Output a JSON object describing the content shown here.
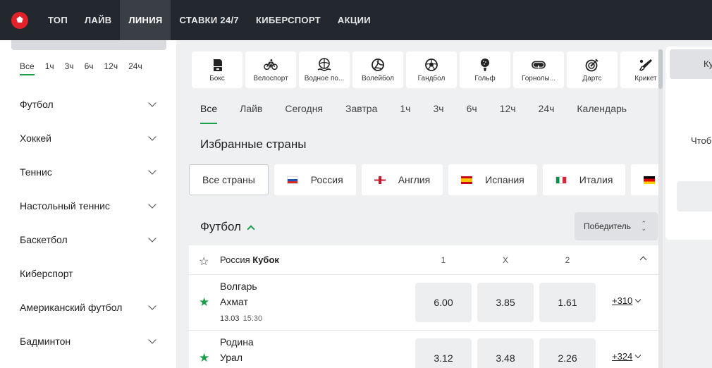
{
  "nav": {
    "items": [
      {
        "label": "ТОП"
      },
      {
        "label": "ЛАЙВ"
      },
      {
        "label": "ЛИНИЯ",
        "active": true
      },
      {
        "label": "СТАВКИ 24/7"
      },
      {
        "label": "КИБЕРСПОРТ"
      },
      {
        "label": "АКЦИИ"
      }
    ]
  },
  "sidebar": {
    "time_filters": [
      "Все",
      "1ч",
      "3ч",
      "6ч",
      "12ч",
      "24ч"
    ],
    "sports": [
      {
        "label": "Футбол",
        "expandable": true
      },
      {
        "label": "Хоккей",
        "expandable": true
      },
      {
        "label": "Теннис",
        "expandable": true
      },
      {
        "label": "Настольный теннис",
        "expandable": true
      },
      {
        "label": "Баскетбол",
        "expandable": true
      },
      {
        "label": "Киберспорт",
        "expandable": false
      },
      {
        "label": "Американский футбол",
        "expandable": true
      },
      {
        "label": "Бадминтон",
        "expandable": true
      }
    ]
  },
  "sport_tiles": [
    {
      "label": "Бокс",
      "icon": "boxing-glove-icon"
    },
    {
      "label": "Велоспорт",
      "icon": "bicycle-icon"
    },
    {
      "label": "Водное по...",
      "icon": "water-polo-icon"
    },
    {
      "label": "Волейбол",
      "icon": "volleyball-icon"
    },
    {
      "label": "Гандбол",
      "icon": "handball-icon"
    },
    {
      "label": "Гольф",
      "icon": "golf-icon"
    },
    {
      "label": "Горнолы...",
      "icon": "ski-goggles-icon"
    },
    {
      "label": "Дартс",
      "icon": "darts-icon"
    },
    {
      "label": "Крикет",
      "icon": "cricket-icon"
    }
  ],
  "tabs": [
    "Все",
    "Лайв",
    "Сегодня",
    "Завтра",
    "1ч",
    "3ч",
    "6ч",
    "12ч",
    "24ч",
    "Календарь"
  ],
  "favorites_title": "Избранные страны",
  "countries": [
    {
      "label": "Все страны",
      "flag": ""
    },
    {
      "label": "Россия",
      "flag": "russia"
    },
    {
      "label": "Англия",
      "flag": "england"
    },
    {
      "label": "Испания",
      "flag": "spain"
    },
    {
      "label": "Италия",
      "flag": "italy"
    },
    {
      "label": "",
      "flag": "germany"
    }
  ],
  "section": {
    "title": "Футбол",
    "market": "Победитель"
  },
  "league": {
    "country": "Россия",
    "name": "Кубок",
    "col_1": "1",
    "col_x": "X",
    "col_2": "2"
  },
  "matches": [
    {
      "team1": "Волгарь",
      "team2": "Ахмат",
      "date": "13.03",
      "time": "15:30",
      "odds": [
        "6.00",
        "3.85",
        "1.61"
      ],
      "more": "+310"
    },
    {
      "team1": "Родина",
      "team2": "Урал",
      "date": "",
      "time": "",
      "odds": [
        "3.12",
        "3.48",
        "2.26"
      ],
      "more": "+324"
    }
  ],
  "right_panel": {
    "tab_label": "Ку",
    "text": "Чтоб"
  },
  "colors": {
    "accent": "#1b9e4a",
    "nav_bg": "#23272e",
    "logo_red": "#e2222b"
  }
}
